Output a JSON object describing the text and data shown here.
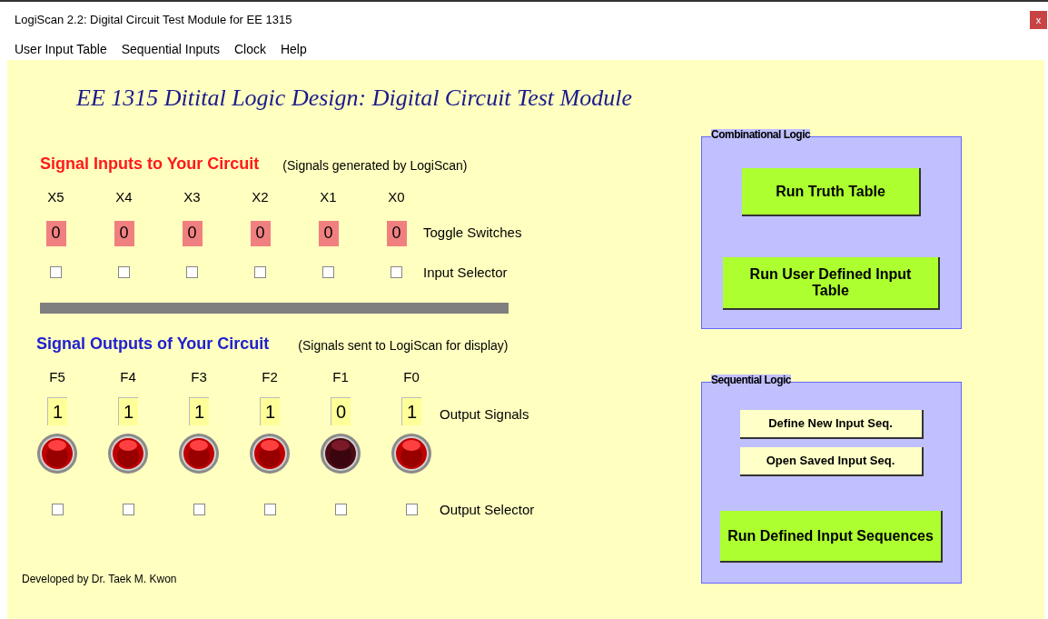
{
  "window": {
    "title": "LogiScan 2.2: Digital Circuit Test Module for EE 1315",
    "close": "x"
  },
  "menu": [
    "User Input Table",
    "Sequential Inputs",
    "Clock",
    "Help"
  ],
  "heading": "EE 1315 Ditital Logic Design: Digital Circuit Test Module",
  "inputs": {
    "title": "Signal Inputs to Your Circuit",
    "note": "(Signals generated by LogiScan)",
    "toggle_label": "Toggle Switches",
    "selector_label": "Input Selector",
    "signals": [
      {
        "name": "X5",
        "value": "0",
        "on": false,
        "checked": false
      },
      {
        "name": "X4",
        "value": "0",
        "on": false,
        "checked": false
      },
      {
        "name": "X3",
        "value": "0",
        "on": false,
        "checked": false
      },
      {
        "name": "X2",
        "value": "0",
        "on": false,
        "checked": false
      },
      {
        "name": "X1",
        "value": "0",
        "on": false,
        "checked": false
      },
      {
        "name": "X0",
        "value": "0",
        "on": false,
        "checked": false
      }
    ]
  },
  "outputs": {
    "title": "Signal Outputs of Your Circuit",
    "note": "(Signals sent to LogiScan for display)",
    "value_label": "Output Signals",
    "selector_label": "Output Selector",
    "signals": [
      {
        "name": "F5",
        "value": "1",
        "on": true,
        "checked": false
      },
      {
        "name": "F4",
        "value": "1",
        "on": true,
        "checked": false
      },
      {
        "name": "F3",
        "value": "1",
        "on": true,
        "checked": false
      },
      {
        "name": "F2",
        "value": "1",
        "on": true,
        "checked": false
      },
      {
        "name": "F1",
        "value": "0",
        "on": false,
        "checked": false
      },
      {
        "name": "F0",
        "value": "1",
        "on": true,
        "checked": false
      }
    ]
  },
  "footer": "Developed by Dr. Taek M. Kwon",
  "combinational": {
    "title": "Combinational Logic",
    "buttons": [
      "Run Truth Table",
      "Run User Defined Input Table"
    ]
  },
  "sequential": {
    "title": "Sequential Logic",
    "buttons": [
      "Define New Input Seq.",
      "Open Saved Input Seq."
    ],
    "run_button": "Run Defined Input Sequences"
  }
}
